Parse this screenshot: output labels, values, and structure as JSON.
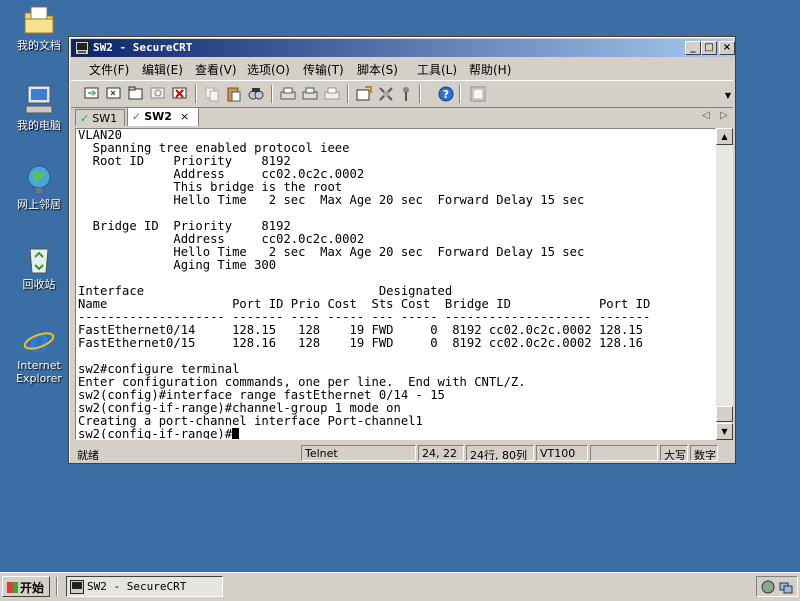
{
  "desktop": {
    "icons": [
      {
        "label": "我的文档",
        "icon": "folder-icon"
      },
      {
        "label": "我的电脑",
        "icon": "computer-icon"
      },
      {
        "label": "网上邻居",
        "icon": "network-icon"
      },
      {
        "label": "回收站",
        "icon": "recycle-bin-icon"
      },
      {
        "label": "Internet Explorer",
        "icon": "ie-icon"
      }
    ]
  },
  "window": {
    "title": "SW2 - SecureCRT",
    "controls": {
      "minimize": "_",
      "maximize": "□",
      "close": "×"
    },
    "menu": [
      "文件(F)",
      "编辑(E)",
      "查看(V)",
      "选项(O)",
      "传输(T)",
      "脚本(S)",
      "工具(L)",
      "帮助(H)"
    ],
    "tabs": [
      {
        "label": "SW1",
        "active": false
      },
      {
        "label": "SW2",
        "active": true,
        "close": "×"
      }
    ],
    "tab_nav": {
      "left": "◁",
      "right": "▷"
    },
    "terminal": {
      "lines": [
        "VLAN20",
        "  Spanning tree enabled protocol ieee",
        "  Root ID    Priority    8192",
        "             Address     cc02.0c2c.0002",
        "             This bridge is the root",
        "             Hello Time   2 sec  Max Age 20 sec  Forward Delay 15 sec",
        "",
        "  Bridge ID  Priority    8192",
        "             Address     cc02.0c2c.0002",
        "             Hello Time   2 sec  Max Age 20 sec  Forward Delay 15 sec",
        "             Aging Time 300",
        "",
        "Interface                                Designated",
        "Name                 Port ID Prio Cost  Sts Cost  Bridge ID            Port ID",
        "-------------------- ------- ---- ----- --- ----- -------------------- -------",
        "FastEthernet0/14     128.15   128    19 FWD     0  8192 cc02.0c2c.0002 128.15",
        "FastEthernet0/15     128.16   128    19 FWD     0  8192 cc02.0c2c.0002 128.16",
        "",
        "sw2#configure terminal",
        "Enter configuration commands, one per line.  End with CNTL/Z.",
        "sw2(config)#interface range fastEthernet 0/14 - 15",
        "sw2(config-if-range)#channel-group 1 mode on",
        "Creating a port-channel interface Port-channel1"
      ],
      "prompt": "sw2(config-if-range)#"
    },
    "status": {
      "ready": "就绪",
      "protocol": "Telnet",
      "position": "24, 22",
      "size": "24行, 80列",
      "emulation": "VT100",
      "blank": "",
      "caps": "大写",
      "num": "数字"
    }
  },
  "taskbar": {
    "start": "开始",
    "task": "SW2 - SecureCRT"
  }
}
